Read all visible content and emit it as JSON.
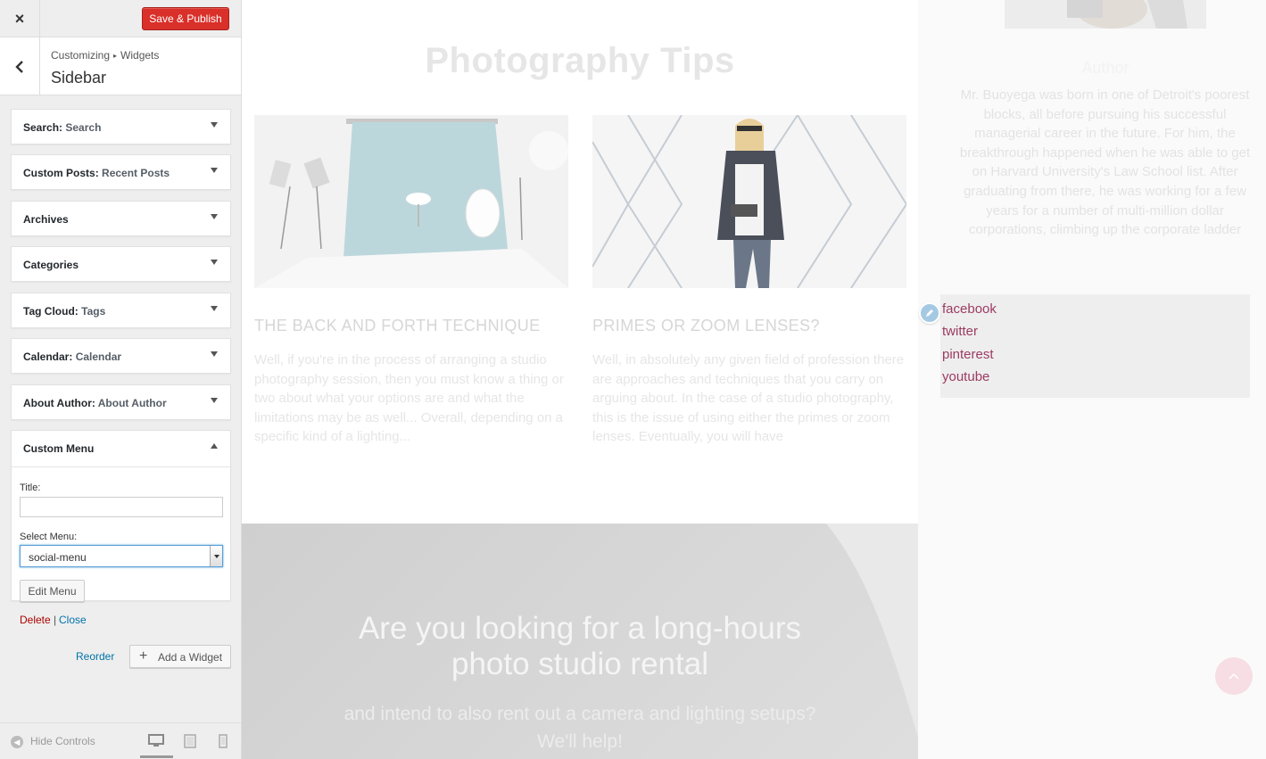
{
  "header": {
    "close_icon": "×",
    "save_label": "Save & Publish"
  },
  "section": {
    "back_icon": "‹",
    "breadcrumb_root": "Customizing",
    "breadcrumb_sep": "▸",
    "breadcrumb_current": "Widgets",
    "title": "Sidebar"
  },
  "widgets": [
    {
      "name": "Search",
      "instance": "Search"
    },
    {
      "name": "Custom Posts",
      "instance": "Recent Posts"
    },
    {
      "name": "Archives",
      "instance": ""
    },
    {
      "name": "Categories",
      "instance": ""
    },
    {
      "name": "Tag Cloud",
      "instance": "Tags"
    },
    {
      "name": "Calendar",
      "instance": "Calendar"
    },
    {
      "name": "About Author",
      "instance": "About Author"
    },
    {
      "name": "Custom Menu",
      "instance": ""
    }
  ],
  "custom_menu_form": {
    "title_label": "Title:",
    "title_value": "",
    "select_label": "Select Menu:",
    "select_value": "social-menu",
    "edit_menu_label": "Edit Menu",
    "delete_label": "Delete",
    "pipe": "|",
    "close_label": "Close"
  },
  "actions": {
    "reorder_label": "Reorder",
    "add_widget_label": "Add a Widget"
  },
  "footer": {
    "hide_controls_label": "Hide Controls",
    "active_device": "desktop"
  },
  "preview": {
    "section_title": "Photography Tips",
    "posts": [
      {
        "title": "THE BACK AND FORTH TECHNIQUE",
        "excerpt": "Well, if you're in the process of arranging a studio photography session, then you must know a thing or two about what your options are and what the limitations may be as well... Overall, depending on a specific kind of a lighting..."
      },
      {
        "title": "PRIMES OR ZOOM LENSES?",
        "excerpt": "Well, in absolutely any given field of profession there are approaches and techniques that you carry on arguing about. In the case of a studio photography, this is the issue of using either the primes or zoom lenses. Eventually, you will have"
      }
    ],
    "banner_title_line1": "Are you looking for a long-hours",
    "banner_title_line2": "photo studio rental",
    "banner_sub_line1": "and intend to also rent out a camera and lighting setups?",
    "banner_sub_line2": "We'll help!",
    "sidebar": {
      "author_name": "Author",
      "author_bio": "Mr. Buoyega was born in one of Detroit's poorest blocks, all before pursuing his successful managerial career in the future. For him, the breakthrough happened when he was able to get on Harvard University's Law School list. After graduating from there, he was working for a few years for a number of multi-million dollar corporations, climbing up the corporate ladder and...",
      "social_links": [
        "facebook",
        "twitter",
        "pinterest",
        "youtube"
      ]
    }
  },
  "colors": {
    "publish_button": "#d9302a",
    "link_blue": "#0073aa",
    "delete_red": "#aa0000",
    "social_link": "#9c3b63",
    "panel_bg": "#eeeeee"
  },
  "icons": {
    "close": "close-icon",
    "back": "chevron-left-icon",
    "widget_toggle": "caret-down-icon",
    "add_widget": "plus-icon",
    "hide_controls": "collapse-icon",
    "devices": [
      "desktop-icon",
      "tablet-icon",
      "mobile-icon"
    ],
    "edit_shortcut": "pencil-icon",
    "scroll_top": "chevron-up-icon"
  }
}
